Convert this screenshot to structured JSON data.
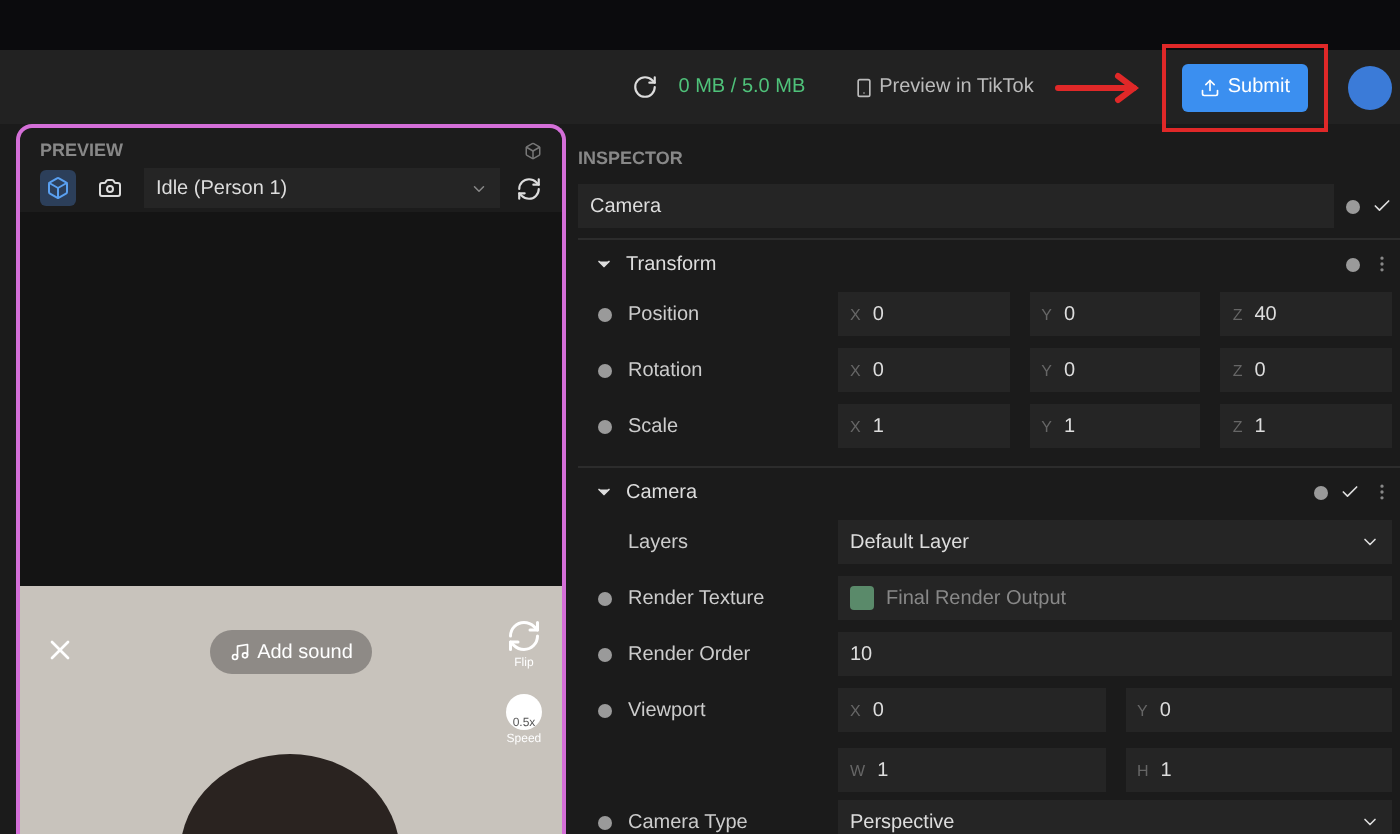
{
  "toolbar": {
    "storage": "0 MB / 5.0 MB",
    "preview_label": "Preview in TikTok",
    "submit": "Submit"
  },
  "preview": {
    "title": "PREVIEW",
    "dropdown": "Idle (Person 1)",
    "overlay": {
      "add_sound": "Add sound",
      "flip": "Flip",
      "speed_value": "0.5x",
      "speed": "Speed"
    }
  },
  "inspector": {
    "title": "INSPECTOR",
    "object_name": "Camera",
    "enabled": true,
    "sections": [
      {
        "title": "Transform",
        "expanded": true,
        "rows": [
          {
            "kind": "vector",
            "label": "Position",
            "keyframe": true,
            "fields": [
              {
                "axis": "X",
                "value": "0"
              },
              {
                "axis": "Y",
                "value": "0"
              },
              {
                "axis": "Z",
                "value": "40"
              }
            ]
          },
          {
            "kind": "vector",
            "label": "Rotation",
            "keyframe": true,
            "fields": [
              {
                "axis": "X",
                "value": "0"
              },
              {
                "axis": "Y",
                "value": "0"
              },
              {
                "axis": "Z",
                "value": "0"
              }
            ]
          },
          {
            "kind": "vector",
            "label": "Scale",
            "keyframe": true,
            "fields": [
              {
                "axis": "X",
                "value": "1"
              },
              {
                "axis": "Y",
                "value": "1"
              },
              {
                "axis": "Z",
                "value": "1"
              }
            ]
          }
        ]
      },
      {
        "title": "Camera",
        "expanded": true,
        "enabled": true,
        "rows": [
          {
            "kind": "dropdown",
            "label": "Layers",
            "keyframe": false,
            "value": "Default Layer"
          },
          {
            "kind": "asset",
            "label": "Render Texture",
            "keyframe": true,
            "value": "Final Render Output"
          },
          {
            "kind": "text",
            "label": "Render Order",
            "keyframe": true,
            "value": "10"
          },
          {
            "kind": "vector",
            "label": "Viewport",
            "keyframe": true,
            "fields": [
              {
                "axis": "X",
                "value": "0"
              },
              {
                "axis": "Y",
                "value": "0"
              },
              {
                "axis": "W",
                "value": "1"
              },
              {
                "axis": "H",
                "value": "1"
              }
            ]
          },
          {
            "kind": "dropdown",
            "label": "Camera Type",
            "keyframe": true,
            "value": "Perspective"
          }
        ]
      }
    ]
  }
}
